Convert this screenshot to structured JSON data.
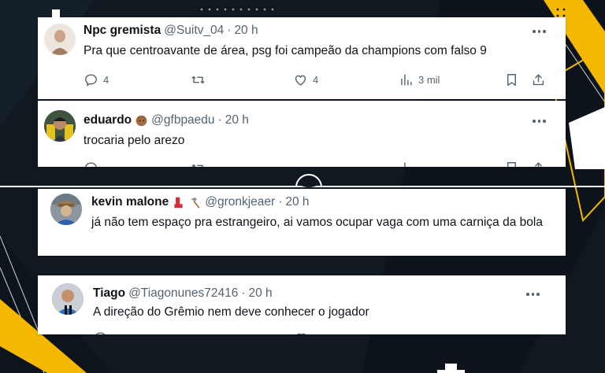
{
  "colors": {
    "background": "#101820",
    "accent_yellow": "#f5b800",
    "card_bg": "#ffffff",
    "text_primary": "#0f1419",
    "text_secondary": "#536471"
  },
  "tweets": [
    {
      "name": "Npc gremista",
      "handle": "@Suitv_04",
      "time": "20 h",
      "text": "Pra que centroavante de área, psg foi campeão da champions com falso 9",
      "replies": "4",
      "likes": "4",
      "views": "3 mil",
      "icons": [
        "reply-icon",
        "retweet-icon",
        "like-icon",
        "views-icon",
        "bookmark-icon",
        "share-icon"
      ]
    },
    {
      "name": "eduardo",
      "handle": "@gfbpaedu",
      "time": "20 h",
      "text": "trocaria pelo arezo",
      "name_emoji": "person-emoji"
    },
    {
      "name": "kevin malone",
      "handle": "@gronkjeaer",
      "time": "20 h",
      "text": "já não tem espaço pra estrangeiro, ai vamos ocupar vaga com uma carniça da bola",
      "name_emoji": [
        "boot-emoji",
        "hammer-emoji"
      ]
    },
    {
      "name": "Tiago",
      "handle": "@Tiagonunes72416",
      "time": "20 h",
      "text": "A direção do Grêmio nem deve conhecer o jogador"
    }
  ],
  "separator": "·"
}
